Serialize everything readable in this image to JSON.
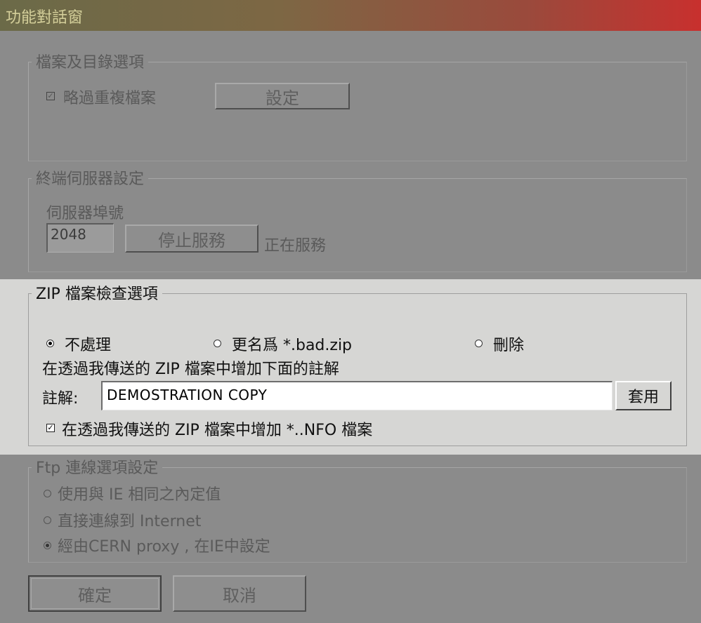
{
  "window": {
    "title": "功能對話窗"
  },
  "file_dir_options": {
    "legend": "檔案及目錄選項",
    "skip_duplicate_label": "略過重複檔案",
    "skip_duplicate_checked": true,
    "settings_button": "設定"
  },
  "terminal_server": {
    "legend": "終端伺服器設定",
    "port_label": "伺服器埠號",
    "port_value": "2048",
    "stop_button": "停止服務",
    "status_text": "正在服務"
  },
  "zip_check": {
    "legend": "ZIP 檔案檢查選項",
    "radio_options": [
      {
        "label": "不處理",
        "selected": true
      },
      {
        "label": "更名爲 *.bad.zip",
        "selected": false
      },
      {
        "label": "刪除",
        "selected": false
      }
    ],
    "comment_description": "在透過我傳送的 ZIP 檔案中增加下面的註解",
    "comment_label": "註解:",
    "comment_value": "DEMOSTRATION COPY",
    "apply_button": "套用",
    "add_nfo_label": "在透過我傳送的 ZIP 檔案中增加 *..NFO 檔案",
    "add_nfo_checked": true
  },
  "ftp_options": {
    "legend": "Ftp 連線選項設定",
    "radio_options": [
      {
        "label": "使用與 IE 相同之內定值",
        "selected": false
      },
      {
        "label": "直接連線到 Internet",
        "selected": false
      },
      {
        "label": "經由CERN proxy , 在IE中設定",
        "selected": true
      }
    ]
  },
  "footer": {
    "ok_button": "確定",
    "cancel_button": "取消"
  }
}
